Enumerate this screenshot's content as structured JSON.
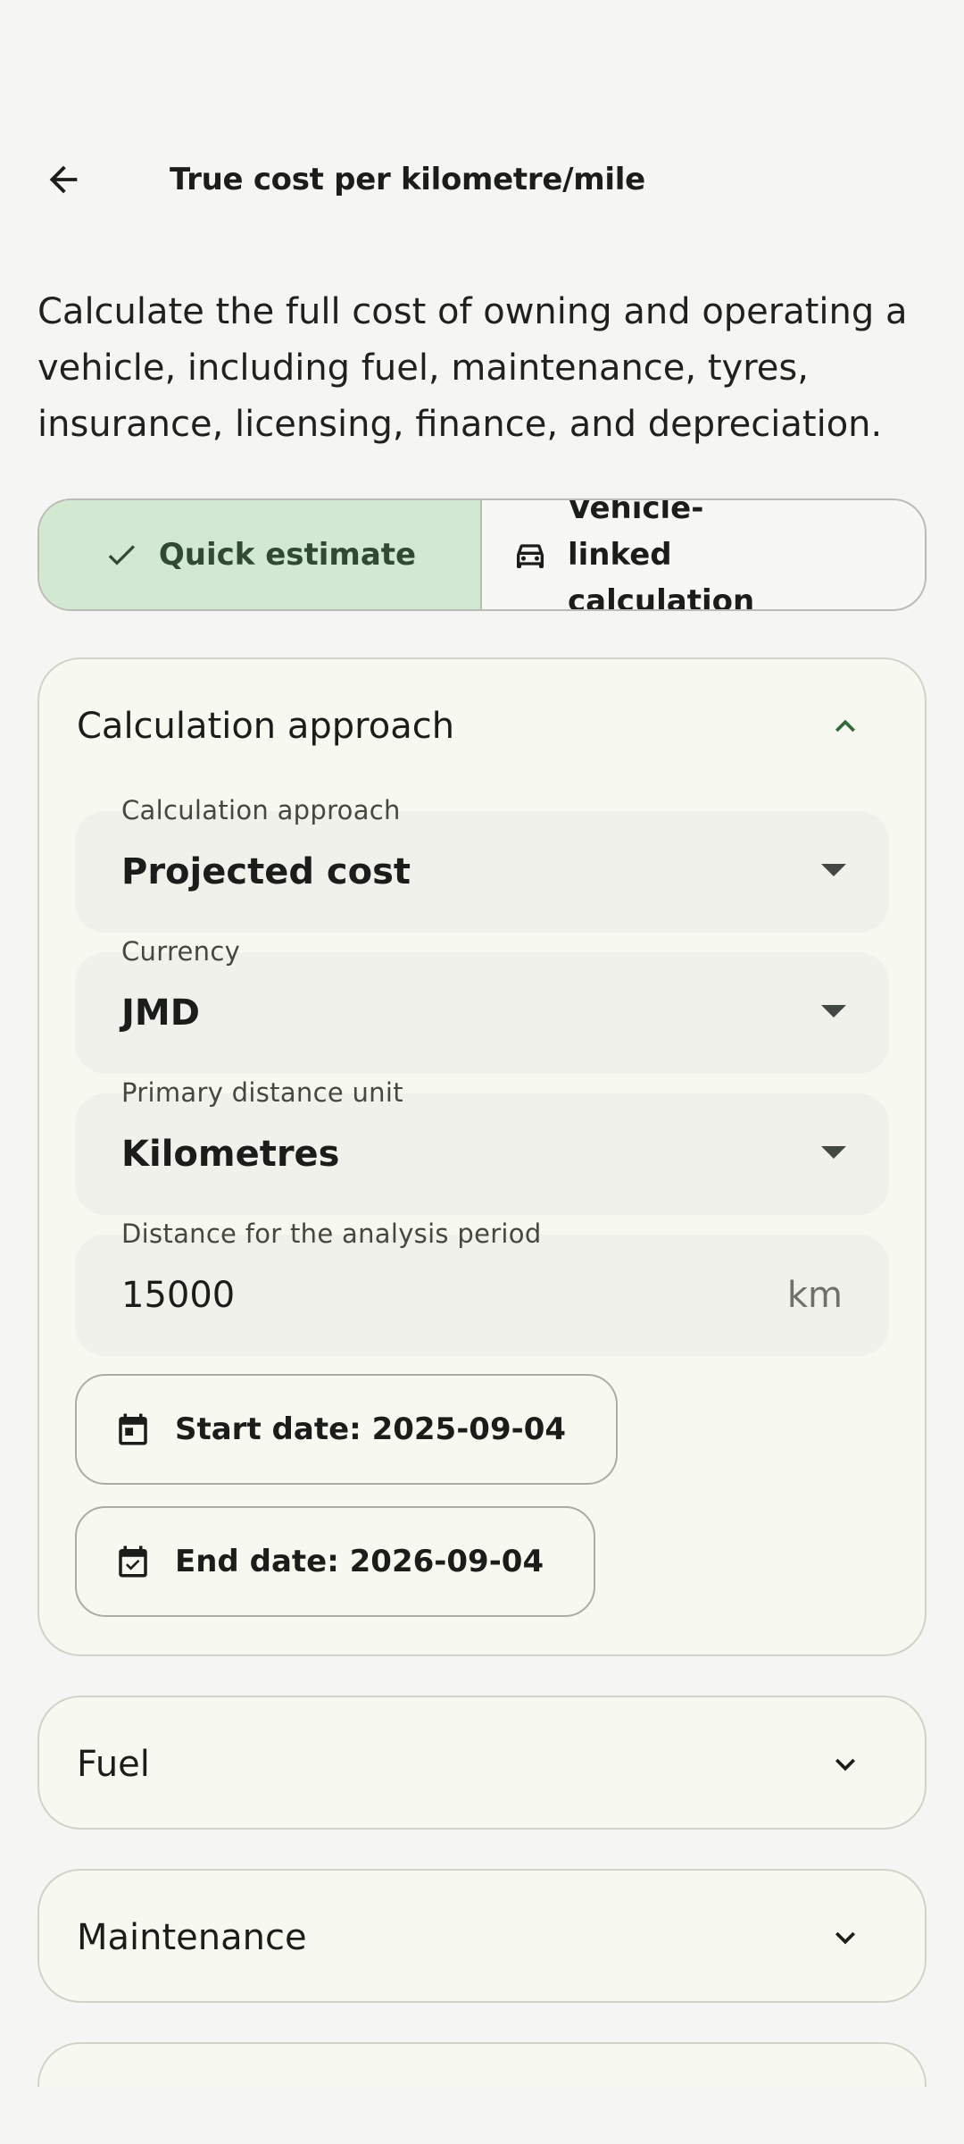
{
  "header": {
    "title": "True cost per kilometre/mile",
    "back_icon": "arrow-back-icon"
  },
  "intro": "Calculate the full cost of owning and operating a vehicle, including fuel, maintenance, tyres, insurance, licensing, finance, and depreciation.",
  "mode_toggle": {
    "options": [
      {
        "label": "Quick estimate",
        "icon": "check-icon",
        "selected": true
      },
      {
        "label": "Vehicle-linked calculation",
        "icon": "car-icon",
        "selected": false
      }
    ]
  },
  "sections": {
    "approach": {
      "title": "Calculation approach",
      "expanded": true,
      "fields": {
        "approach": {
          "label": "Calculation approach",
          "value": "Projected cost"
        },
        "currency": {
          "label": "Currency",
          "value": "JMD"
        },
        "distance_unit": {
          "label": "Primary distance unit",
          "value": "Kilometres"
        },
        "distance": {
          "label": "Distance for the analysis period",
          "value": "15000",
          "suffix": "km"
        }
      },
      "start_date": "Start date: 2025-09-04",
      "end_date": "End date: 2026-09-04"
    },
    "fuel": {
      "title": "Fuel",
      "expanded": false
    },
    "maintenance": {
      "title": "Maintenance",
      "expanded": false
    }
  },
  "colors": {
    "accent": "#2f6b36",
    "selected_segment": "#d3e8d0",
    "card_bg": "#f7f9f1",
    "field_bg": "#eff1ea"
  }
}
